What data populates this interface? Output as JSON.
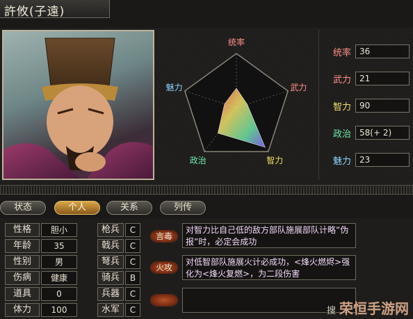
{
  "header": {
    "name": "許攸(子遠)"
  },
  "radar": {
    "labels": {
      "command": "统率",
      "war": "武力",
      "intel": "智力",
      "politics": "政治",
      "charm": "魅力"
    },
    "values": {
      "command": 36,
      "war": 21,
      "intel": 90,
      "politics": 58,
      "charm": 23
    },
    "max": 100
  },
  "stats": [
    {
      "label": "统率",
      "value": "36",
      "color": "#ff8f8a"
    },
    {
      "label": "武力",
      "value": "21",
      "color": "#ff8f8a"
    },
    {
      "label": "智力",
      "value": "90",
      "color": "#f4e06a"
    },
    {
      "label": "政治",
      "value": "58(+ 2)",
      "color": "#6fe6a8"
    },
    {
      "label": "魅力",
      "value": "23",
      "color": "#8bd2ff"
    }
  ],
  "tabs": [
    {
      "label": "状态",
      "active": false
    },
    {
      "label": "个人",
      "active": true
    },
    {
      "label": "关系",
      "active": false
    },
    {
      "label": "列传",
      "active": false
    }
  ],
  "info": [
    {
      "label": "性格",
      "value": "胆小"
    },
    {
      "label": "年龄",
      "value": "35"
    },
    {
      "label": "性别",
      "value": "男"
    },
    {
      "label": "伤病",
      "value": "健康"
    },
    {
      "label": "道具",
      "value": "0"
    },
    {
      "label": "体力",
      "value": "100"
    }
  ],
  "aptitudes": [
    {
      "label": "枪兵",
      "value": "C"
    },
    {
      "label": "戟兵",
      "value": "C"
    },
    {
      "label": "弩兵",
      "value": "C"
    },
    {
      "label": "骑兵",
      "value": "B"
    },
    {
      "label": "兵器",
      "value": "C"
    },
    {
      "label": "水军",
      "value": "C"
    }
  ],
  "skills": [
    {
      "name": "言毒",
      "desc": "对智力比自己低的敌方部队施展部队计略“伪报”时，必定会成功"
    },
    {
      "name": "火攻",
      "desc": "对低智部队施展火计必成功，<烽火燃烬>强化为<烽火复燃>，为二段伤害"
    },
    {
      "name": "",
      "desc": ""
    }
  ],
  "watermark": {
    "text": "荣恒手游网",
    "prefix": "搜"
  },
  "colors": {
    "accent": "#d8a548",
    "panel": "#1e1d1b",
    "border": "#6f6a5e"
  }
}
